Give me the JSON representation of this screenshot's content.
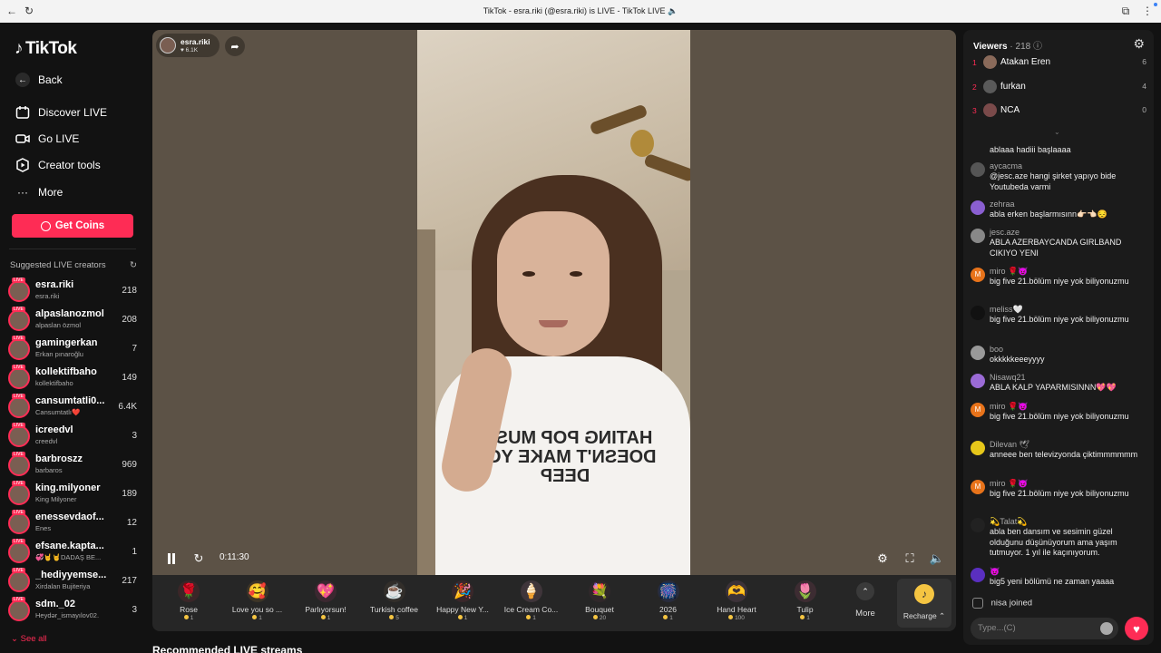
{
  "browser": {
    "title": "TikTok - esra.riki (@esra.riki) is LIVE - TikTok LIVE 🔈",
    "back_icon": "←",
    "reload_icon": "↻"
  },
  "sidebar": {
    "logo": "TikTok",
    "nav": [
      {
        "label": "Back",
        "icon": "back-arrow-icon"
      },
      {
        "label": "Discover LIVE",
        "icon": "calendar-icon"
      },
      {
        "label": "Go LIVE",
        "icon": "camera-icon"
      },
      {
        "label": "Creator tools",
        "icon": "creator-tools-icon"
      },
      {
        "label": "More",
        "icon": "more-dots-icon"
      }
    ],
    "get_coins": "Get Coins",
    "suggested_title": "Suggested LIVE creators",
    "creators": [
      {
        "name": "esra.riki",
        "sub": "esra.riki",
        "count": "218"
      },
      {
        "name": "alpaslanozmol",
        "sub": "alpaslan özmol",
        "count": "208"
      },
      {
        "name": "gamingerkan",
        "sub": "Erkan pınaroğlu",
        "count": "7"
      },
      {
        "name": "kollektifbaho",
        "sub": "kollektifbaho",
        "count": "149"
      },
      {
        "name": "cansumtatli0...",
        "sub": "Cansumtatlı❤️",
        "count": "6.4K"
      },
      {
        "name": "icreedvl",
        "sub": "creedvl",
        "count": "3"
      },
      {
        "name": "barbroszz",
        "sub": "barbaros",
        "count": "969"
      },
      {
        "name": "king.milyoner",
        "sub": "King Milyoner",
        "count": "189"
      },
      {
        "name": "enessevdaof...",
        "sub": "Enes",
        "count": "12"
      },
      {
        "name": "efsane.kapta...",
        "sub": "💞🤘🤘DADAŞ BE...",
        "count": "1"
      },
      {
        "name": "_hediyyemse...",
        "sub": "Xirdalan Bujiteriya",
        "count": "217"
      },
      {
        "name": "sdm._02",
        "sub": "Heydər_ismayılov02.",
        "count": "3"
      }
    ],
    "see_all": "See all"
  },
  "player": {
    "host_name": "esra.riki",
    "host_likes": "♥ 6.1K",
    "time": "0:11:30",
    "shirt_text": "HATING POP MUSIC DOESN'T MAKE YOU DEEP"
  },
  "gifts": [
    {
      "name": "Rose",
      "price": "1",
      "icon": "🌹"
    },
    {
      "name": "Love you so ...",
      "price": "1",
      "icon": "🥰"
    },
    {
      "name": "Parlıyorsun!",
      "price": "1",
      "icon": "💖"
    },
    {
      "name": "Turkish coffee",
      "price": "5",
      "icon": "☕"
    },
    {
      "name": "Happy New Y...",
      "price": "1",
      "icon": "🎉"
    },
    {
      "name": "Ice Cream Co...",
      "price": "1",
      "icon": "🍦"
    },
    {
      "name": "Bouquet",
      "price": "20",
      "icon": "💐"
    },
    {
      "name": "2026",
      "price": "1",
      "icon": "🎆"
    },
    {
      "name": "Hand Heart",
      "price": "100",
      "icon": "🫶"
    },
    {
      "name": "Tulip",
      "price": "1",
      "icon": "🌷"
    }
  ],
  "gift_more": "More",
  "recharge": "Recharge ⌃",
  "recommended_title": "Recommended LIVE streams",
  "viewers": {
    "label": "Viewers",
    "count": "· 218",
    "top": [
      {
        "rank": "1",
        "name": "Atakan Eren",
        "score": "6"
      },
      {
        "rank": "2",
        "name": "furkan",
        "score": "4"
      },
      {
        "rank": "3",
        "name": "NCA",
        "score": "0"
      }
    ]
  },
  "chat": [
    {
      "user": "",
      "text": "ablaaa hadiii başlaaaa",
      "color": "#666666",
      "init": ""
    },
    {
      "user": "aycacma",
      "text": "@jesc.aze hangi şirket yapıyo bide Youtubeda varmi",
      "color": "#555555",
      "init": ""
    },
    {
      "user": "zehraa",
      "text": "abla erken başlarmısınn👉🏻👈🏻😔",
      "color": "#8a5fd1",
      "init": ""
    },
    {
      "user": "jesc.aze",
      "text": "ABLA AZERBAYCANDA GIRLBAND CIKIYO YENI",
      "color": "#888888",
      "init": ""
    },
    {
      "user": "miro 🌹😈",
      "text": "big five 21.bölüm niye yok biliyonuzmu",
      "color": "#e8731a",
      "init": "M"
    },
    {
      "user": "meliss🤍",
      "text": "big five 21.bölüm niye yok biliyonuzmu",
      "color": "#111111",
      "init": ""
    },
    {
      "user": "boo",
      "text": "okkkkkeeeyyyy",
      "color": "#999999",
      "init": ""
    },
    {
      "user": "Nisawq21",
      "text": "ABLA KALP YAPARMISINNN💖💖",
      "color": "#9b6bd6",
      "init": ""
    },
    {
      "user": "miro 🌹😈",
      "text": "big five 21.bölüm niye yok biliyonuzmu",
      "color": "#e8731a",
      "init": "M"
    },
    {
      "user": "Dilevan 🕊",
      "text": "anneee ben televizyonda çiktimmmmmm",
      "color": "#e6c71a",
      "init": ""
    },
    {
      "user": "miro 🌹😈",
      "text": "big five 21.bölüm niye yok biliyonuzmu",
      "color": "#e8731a",
      "init": "M"
    },
    {
      "user": "💫Talat💫",
      "text": "abla ben dansım ve sesimin güzel olduğunu düşünüyorum ama yaşım tutmuyor. 1 yıl ile kaçınıyorum.",
      "color": "#222222",
      "init": ""
    },
    {
      "user": "😈",
      "text": "big5 yeni bölümü ne zaman yaaaa",
      "color": "#5a2fc0",
      "init": ""
    }
  ],
  "joined": {
    "user": "nisa",
    "text": "joined"
  },
  "chat_input": {
    "placeholder": "Type...(C)"
  },
  "colors": {
    "accent": "#fe2c55",
    "panel": "#1b1b1b",
    "bg": "#121212"
  }
}
